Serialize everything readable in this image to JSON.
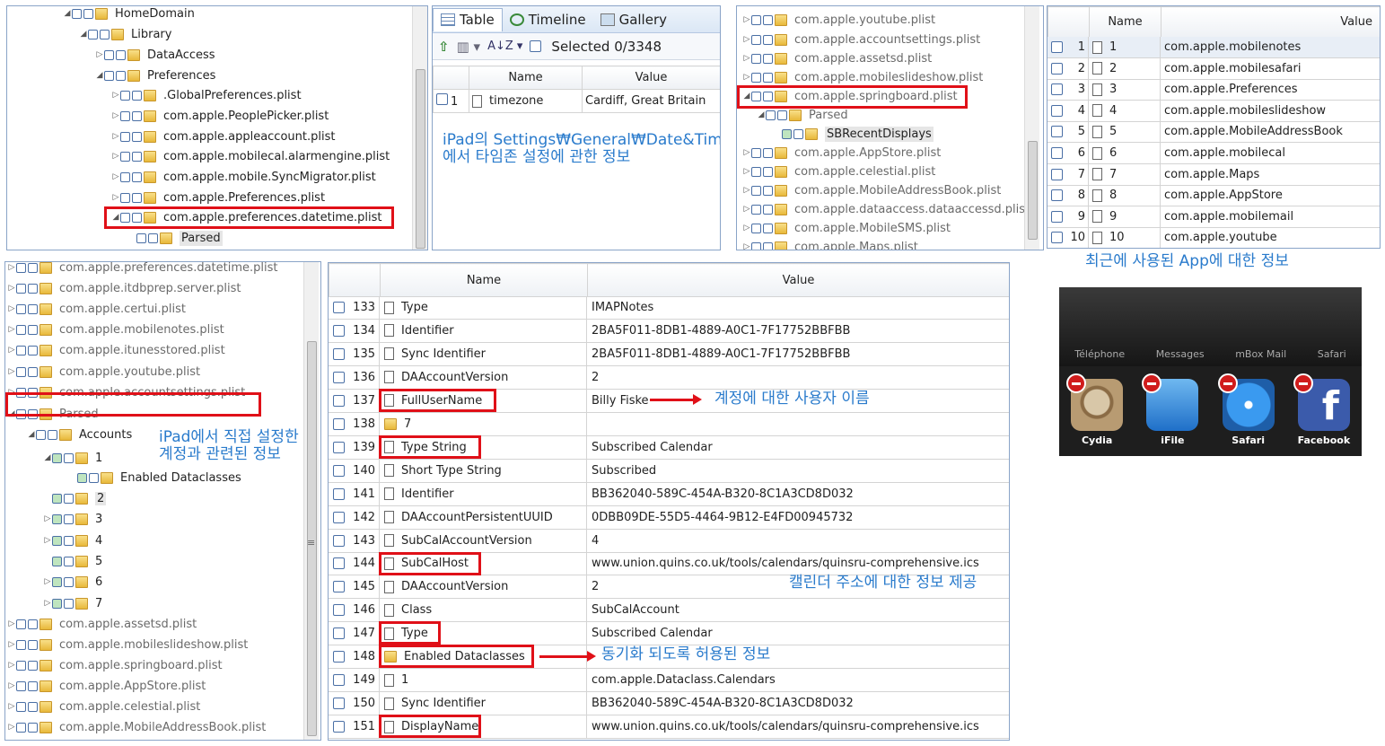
{
  "panel1": {
    "tree": [
      {
        "label": "HomeDomain"
      },
      {
        "label": "Library"
      },
      {
        "label": "DataAccess"
      },
      {
        "label": "Preferences"
      },
      {
        "label": ".GlobalPreferences.plist"
      },
      {
        "label": "com.apple.PeoplePicker.plist"
      },
      {
        "label": "com.apple.appleaccount.plist"
      },
      {
        "label": "com.apple.mobilecal.alarmengine.plist"
      },
      {
        "label": "com.apple.mobile.SyncMigrator.plist"
      },
      {
        "label": "com.apple.Preferences.plist"
      },
      {
        "label": "com.apple.preferences.datetime.plist"
      },
      {
        "label": "Parsed"
      }
    ]
  },
  "panel2": {
    "tabs": [
      "Table",
      "Timeline",
      "Gallery"
    ],
    "selected": "Selected 0/3348",
    "columns": [
      "Name",
      "Value"
    ],
    "rows": [
      {
        "num": "1",
        "name": "timezone",
        "value": "Cardiff, Great Britain"
      }
    ],
    "annotation_line1": "iPad의 Settings₩General₩Date&Time",
    "annotation_line2": "에서 타임존 설정에 관한 정보"
  },
  "panel3": {
    "tree": [
      {
        "label": "com.apple.youtube.plist"
      },
      {
        "label": "com.apple.accountsettings.plist"
      },
      {
        "label": "com.apple.assetsd.plist"
      },
      {
        "label": "com.apple.mobileslideshow.plist"
      },
      {
        "label": "com.apple.springboard.plist"
      },
      {
        "label": "Parsed"
      },
      {
        "label": "SBRecentDisplays"
      },
      {
        "label": "com.apple.AppStore.plist"
      },
      {
        "label": "com.apple.celestial.plist"
      },
      {
        "label": "com.apple.MobileAddressBook.plist"
      },
      {
        "label": "com.apple.dataaccess.dataaccessd.plist"
      },
      {
        "label": "com.apple.MobileSMS.plist"
      },
      {
        "label": "com.apple.Maps.plist"
      }
    ]
  },
  "panel4": {
    "columns": [
      "Name",
      "Value"
    ],
    "rows": [
      {
        "num": "1",
        "name": "1",
        "value": "com.apple.mobilenotes"
      },
      {
        "num": "2",
        "name": "2",
        "value": "com.apple.mobilesafari"
      },
      {
        "num": "3",
        "name": "3",
        "value": "com.apple.Preferences"
      },
      {
        "num": "4",
        "name": "4",
        "value": "com.apple.mobileslideshow"
      },
      {
        "num": "5",
        "name": "5",
        "value": "com.apple.MobileAddressBook"
      },
      {
        "num": "6",
        "name": "6",
        "value": "com.apple.mobilecal"
      },
      {
        "num": "7",
        "name": "7",
        "value": "com.apple.Maps"
      },
      {
        "num": "8",
        "name": "8",
        "value": "com.apple.AppStore"
      },
      {
        "num": "9",
        "name": "9",
        "value": "com.apple.mobilemail"
      },
      {
        "num": "10",
        "name": "10",
        "value": "com.apple.youtube"
      }
    ],
    "caption": "최근에 사용된 App에 대한 정보"
  },
  "panel5": {
    "tree": [
      {
        "label": "com.apple.preferences.datetime.plist"
      },
      {
        "label": "com.apple.itdbprep.server.plist"
      },
      {
        "label": "com.apple.certui.plist"
      },
      {
        "label": "com.apple.mobilenotes.plist"
      },
      {
        "label": "com.apple.itunesstored.plist"
      },
      {
        "label": "com.apple.youtube.plist"
      },
      {
        "label": "com.apple.accountsettings.plist"
      },
      {
        "label": "Parsed"
      },
      {
        "label": "Accounts"
      },
      {
        "label": "1"
      },
      {
        "label": "Enabled Dataclasses"
      },
      {
        "label": "2"
      },
      {
        "label": "3"
      },
      {
        "label": "4"
      },
      {
        "label": "5"
      },
      {
        "label": "6"
      },
      {
        "label": "7"
      },
      {
        "label": "com.apple.assetsd.plist"
      },
      {
        "label": "com.apple.mobileslideshow.plist"
      },
      {
        "label": "com.apple.springboard.plist"
      },
      {
        "label": "com.apple.AppStore.plist"
      },
      {
        "label": "com.apple.celestial.plist"
      },
      {
        "label": "com.apple.MobileAddressBook.plist"
      }
    ],
    "annotation_line1": "iPad에서 직접 설정한",
    "annotation_line2": "계정과 관련된 정보"
  },
  "panel6": {
    "columns": [
      "Name",
      "Value"
    ],
    "rows": [
      {
        "num": "133",
        "name": "Type",
        "value": "IMAPNotes"
      },
      {
        "num": "134",
        "name": "Identifier",
        "value": "2BA5F011-8DB1-4889-A0C1-7F17752BBFBB"
      },
      {
        "num": "135",
        "name": "Sync Identifier",
        "value": "2BA5F011-8DB1-4889-A0C1-7F17752BBFBB"
      },
      {
        "num": "136",
        "name": "DAAccountVersion",
        "value": "2"
      },
      {
        "num": "137",
        "name": "FullUserName",
        "value": "Billy Fiske"
      },
      {
        "num": "138",
        "name": "7",
        "value": ""
      },
      {
        "num": "139",
        "name": "Type String",
        "value": "Subscribed Calendar"
      },
      {
        "num": "140",
        "name": "Short Type String",
        "value": "Subscribed"
      },
      {
        "num": "141",
        "name": "Identifier",
        "value": "BB362040-589C-454A-B320-8C1A3CD8D032"
      },
      {
        "num": "142",
        "name": "DAAccountPersistentUUID",
        "value": "0DBB09DE-55D5-4464-9B12-E4FD00945732"
      },
      {
        "num": "143",
        "name": "SubCalAccountVersion",
        "value": "4"
      },
      {
        "num": "144",
        "name": "SubCalHost",
        "value": "www.union.quins.co.uk/tools/calendars/quinsru-comprehensive.ics"
      },
      {
        "num": "145",
        "name": "DAAccountVersion",
        "value": "2"
      },
      {
        "num": "146",
        "name": "Class",
        "value": "SubCalAccount"
      },
      {
        "num": "147",
        "name": "Type",
        "value": "Subscribed Calendar"
      },
      {
        "num": "148",
        "name": "Enabled Dataclasses",
        "value": ""
      },
      {
        "num": "149",
        "name": "1",
        "value": "com.apple.Dataclass.Calendars"
      },
      {
        "num": "150",
        "name": "Sync Identifier",
        "value": "BB362040-589C-454A-B320-8C1A3CD8D032"
      },
      {
        "num": "151",
        "name": "DisplayName",
        "value": "www.union.quins.co.uk/tools/calendars/quinsru-comprehensive.ics"
      }
    ],
    "note_username": "계정에 대한 사용자 이름",
    "note_calendar": "캘린더 주소에 대한 정보 제공",
    "note_sync": "동기화 되도록 허용된 정보"
  },
  "ios": {
    "dock_labels": [
      "Téléphone",
      "Messages",
      "mBox Mail",
      "Safari"
    ],
    "apps": [
      "Cydia",
      "iFile",
      "Safari",
      "Facebook"
    ]
  }
}
